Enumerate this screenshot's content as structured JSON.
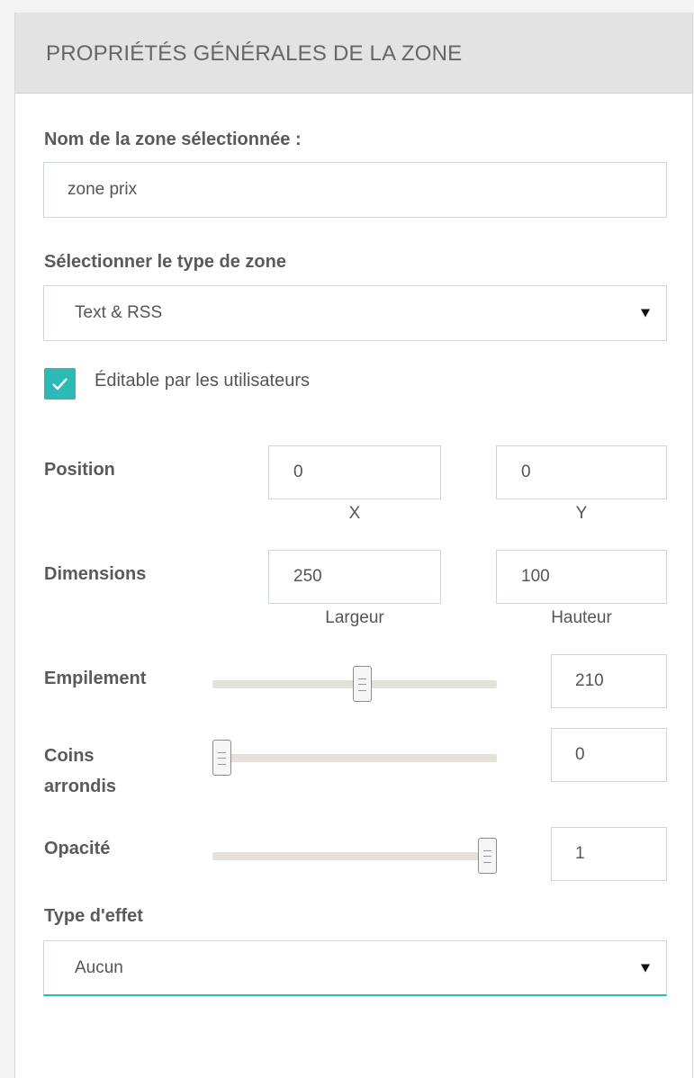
{
  "panel": {
    "title": "PROPRIÉTÉS GÉNÉRALES DE LA ZONE"
  },
  "zone_name": {
    "label": "Nom de la zone sélectionnée :",
    "value": "zone prix"
  },
  "zone_type": {
    "label": "Sélectionner le type de zone",
    "selected": "Text & RSS"
  },
  "editable": {
    "label": "Éditable par les utilisateurs",
    "checked": true
  },
  "position": {
    "label": "Position",
    "x_value": "0",
    "x_caption": "X",
    "y_value": "0",
    "y_caption": "Y"
  },
  "dimensions": {
    "label": "Dimensions",
    "width_value": "250",
    "width_caption": "Largeur",
    "height_value": "100",
    "height_caption": "Hauteur"
  },
  "sliders": [
    {
      "label": "Empilement",
      "value": "210",
      "level": 0.53
    },
    {
      "label": "Coins arrondis",
      "value": "0",
      "level": 0.0
    },
    {
      "label": "Opacité",
      "value": "1",
      "level": 1.0
    }
  ],
  "effect_type": {
    "label": "Type d'effet",
    "selected": "Aucun"
  },
  "colors": {
    "accent": "#2fb9b4",
    "header_bg": "#e3e3e3"
  }
}
